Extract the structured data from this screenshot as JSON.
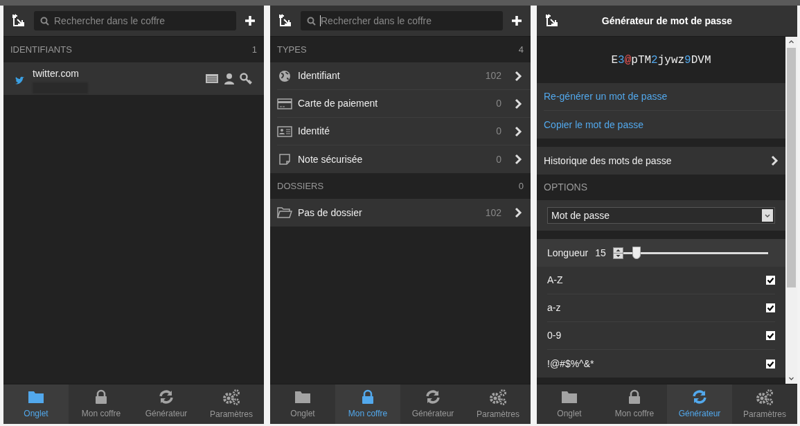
{
  "tab_panel": {
    "search": {
      "placeholder": "Rechercher dans le coffre"
    },
    "sections": [
      {
        "title": "IDENTIFIANTS",
        "count": "1",
        "items": [
          {
            "kind": "login",
            "title": "twitter.com"
          }
        ]
      }
    ],
    "nav": [
      {
        "label": "Onglet",
        "selected": true
      },
      {
        "label": "Mon coffre",
        "selected": false
      },
      {
        "label": "Générateur",
        "selected": false
      },
      {
        "label": "Paramètres",
        "selected": false
      }
    ]
  },
  "vault_panel": {
    "search": {
      "placeholder": "Rechercher dans le coffre",
      "focused": true
    },
    "sections": [
      {
        "title": "TYPES",
        "count": "4",
        "items": [
          {
            "kind": "globe",
            "title": "Identifiant",
            "count": "102"
          },
          {
            "kind": "card",
            "title": "Carte de paiement",
            "count": "0"
          },
          {
            "kind": "identity",
            "title": "Identité",
            "count": "0"
          },
          {
            "kind": "note",
            "title": "Note sécurisée",
            "count": "0"
          }
        ]
      },
      {
        "title": "DOSSIERS",
        "count": "0",
        "items": [
          {
            "kind": "folder",
            "title": "Pas de dossier",
            "count": "102"
          }
        ]
      }
    ],
    "nav": [
      {
        "label": "Onglet",
        "selected": false
      },
      {
        "label": "Mon coffre",
        "selected": true
      },
      {
        "label": "Générateur",
        "selected": false
      },
      {
        "label": "Paramètres",
        "selected": false
      }
    ]
  },
  "generator_panel": {
    "title": "Générateur de mot de passe",
    "password": [
      {
        "kind": "letter",
        "text": "E"
      },
      {
        "kind": "digit",
        "text": "3"
      },
      {
        "kind": "symbol",
        "text": "@"
      },
      {
        "kind": "letter",
        "text": "pTM"
      },
      {
        "kind": "digit",
        "text": "2"
      },
      {
        "kind": "letter",
        "text": "jywz"
      },
      {
        "kind": "digit",
        "text": "9"
      },
      {
        "kind": "letter",
        "text": "DVM"
      }
    ],
    "actions": [
      "Re-générer un mot de passe",
      "Copier le mot de passe"
    ],
    "history": "Historique des mots de passe",
    "options_title": "OPTIONS",
    "type_select": "Mot de passe",
    "length": {
      "label": "Longueur",
      "value": "15",
      "level": 0.09
    },
    "checkboxes": [
      {
        "label": "A-Z",
        "checked": true
      },
      {
        "label": "a-z",
        "checked": true
      },
      {
        "label": "0-9",
        "checked": true
      },
      {
        "label": "!@#$%^&*",
        "checked": true
      }
    ],
    "nav": [
      {
        "label": "Onglet",
        "selected": false
      },
      {
        "label": "Mon coffre",
        "selected": false
      },
      {
        "label": "Générateur",
        "selected": true
      },
      {
        "label": "Paramètres",
        "selected": false
      }
    ]
  }
}
